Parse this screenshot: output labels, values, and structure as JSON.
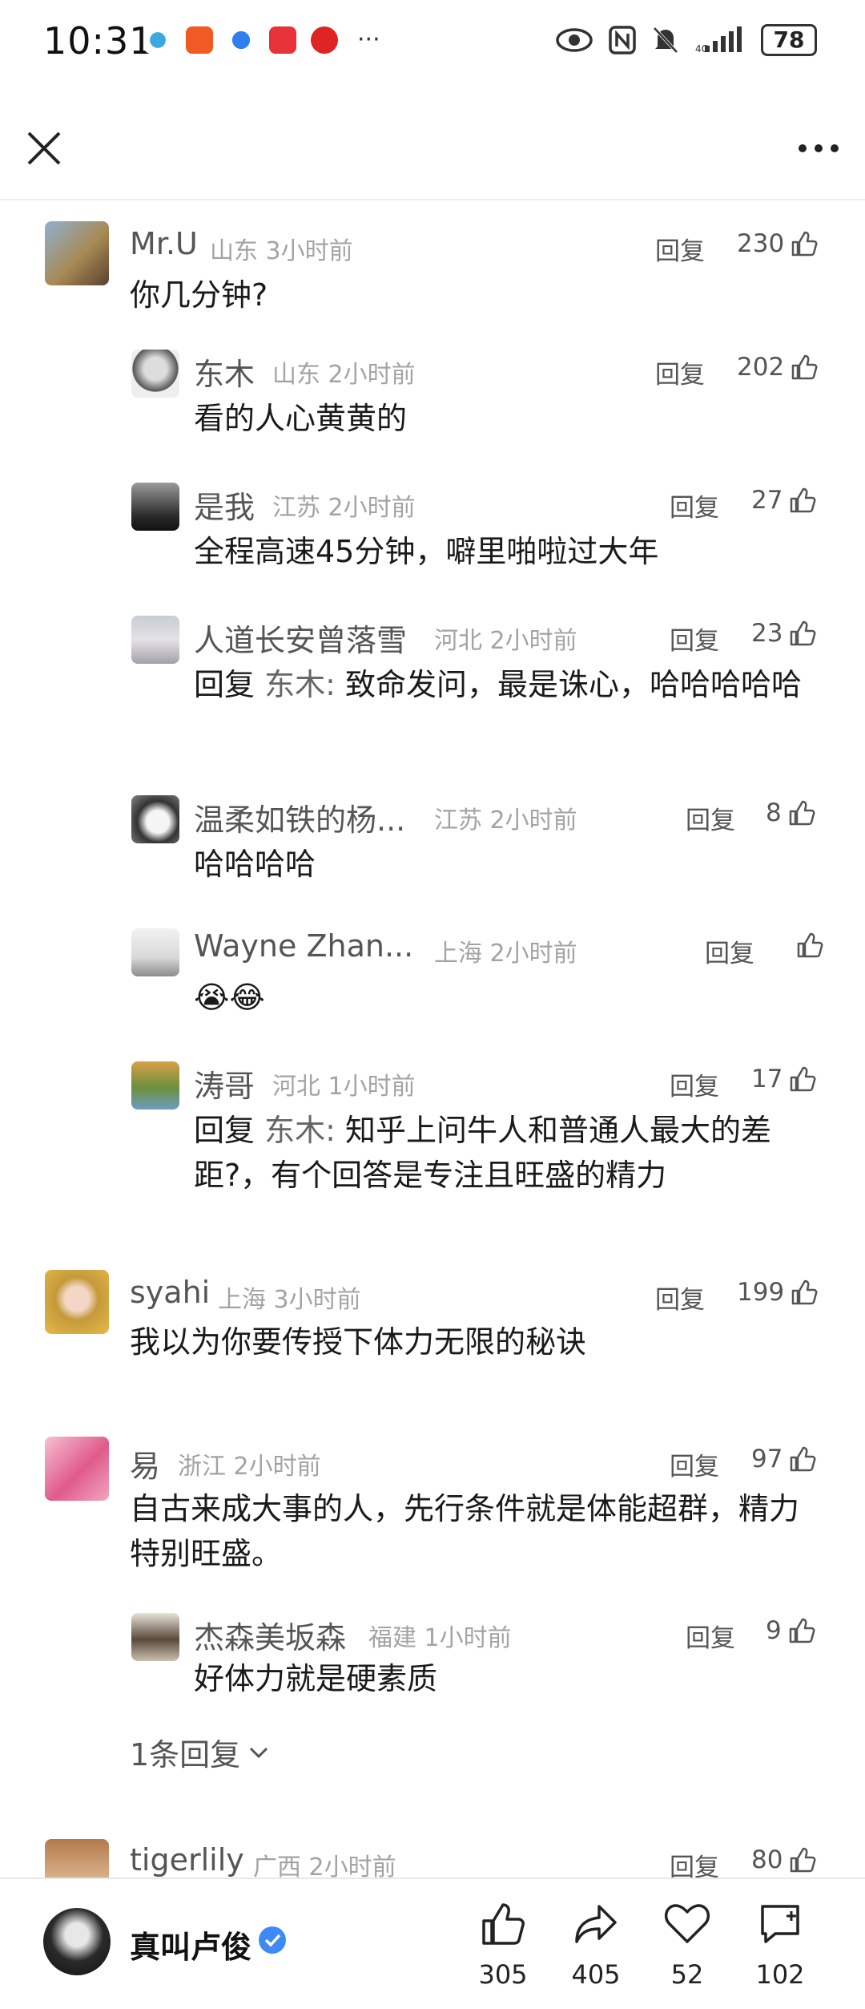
{
  "status_bar": {
    "time": "10:31",
    "more": "···",
    "battery": "78"
  },
  "comments": [
    {
      "user": "Mr.U",
      "meta": "山东 3小时前",
      "reply": "回复",
      "likes": "230",
      "text": "你几分钟?"
    },
    {
      "user": "东木",
      "meta": "山东 2小时前",
      "reply": "回复",
      "likes": "202",
      "text": "看的人心黄黄的"
    },
    {
      "user": "是我",
      "meta": "江苏 2小时前",
      "reply": "回复",
      "likes": "27",
      "text": "全程高速45分钟，噼里啪啦过大年"
    },
    {
      "user": "人道长安曾落雪",
      "meta": "河北 2小时前",
      "reply": "回复",
      "likes": "23",
      "reply_prefix": "回复",
      "reply_to": "东木:",
      "text": " 致命发问，最是诛心，哈哈哈哈哈"
    },
    {
      "user": "温柔如铁的杨...",
      "meta": "江苏 2小时前",
      "reply": "回复",
      "likes": "8",
      "text": "哈哈哈哈"
    },
    {
      "user": "Wayne Zhan...",
      "meta": "上海 2小时前",
      "reply": "回复",
      "likes": "",
      "text": "😭😂"
    },
    {
      "user": "涛哥",
      "meta": "河北 1小时前",
      "reply": "回复",
      "likes": "17",
      "reply_prefix": "回复",
      "reply_to": "东木:",
      "text": " 知乎上问牛人和普通人最大的差距?，有个回答是专注且旺盛的精力"
    },
    {
      "user": "syahi",
      "meta": "上海 3小时前",
      "reply": "回复",
      "likes": "199",
      "text": "我以为你要传授下体力无限的秘诀"
    },
    {
      "user": "易",
      "meta": "浙江 2小时前",
      "reply": "回复",
      "likes": "97",
      "text": "自古来成大事的人，先行条件就是体能超群，精力特别旺盛。"
    },
    {
      "user": "杰森美坂森",
      "meta": "福建 1小时前",
      "reply": "回复",
      "likes": "9",
      "text": "好体力就是硬素质"
    },
    {
      "user": "tigerlily",
      "meta": "广西 2小时前",
      "reply": "回复",
      "likes": "80",
      "text": ""
    }
  ],
  "expand_replies": "1条回复",
  "bottom_bar": {
    "author": "真叫卢俊",
    "like_count": "305",
    "share_count": "405",
    "favorite_count": "52",
    "comment_count": "102"
  },
  "colors": {
    "verified": "#3d8af7",
    "text": "#1a1a1a",
    "meta": "#a3a3a3"
  }
}
